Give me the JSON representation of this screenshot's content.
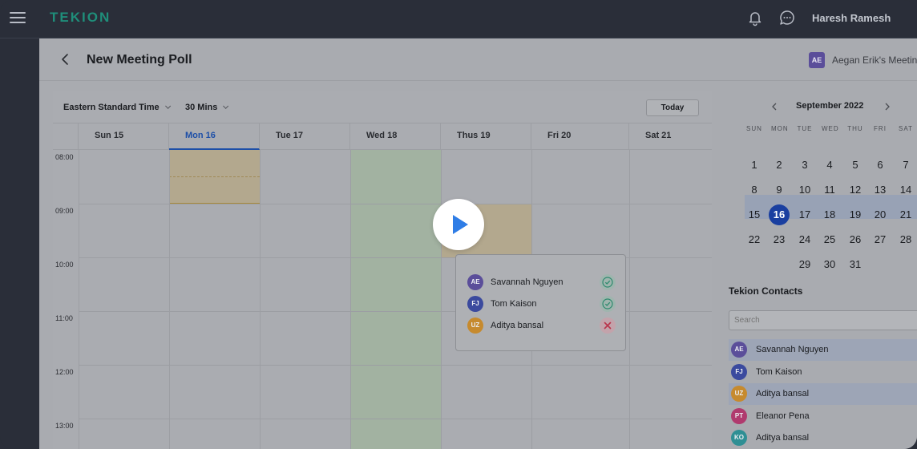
{
  "topbar": {
    "logo": "TEKION",
    "user_name": "Haresh Ramesh",
    "icons": [
      "menu-icon",
      "bell-icon",
      "chat-icon"
    ]
  },
  "header": {
    "title": "New Meeting Poll",
    "owner_initials": "AE",
    "owner_label": "Aegan Erik's Meeting"
  },
  "toolbar": {
    "timezone": "Eastern Standard Time",
    "duration": "30 Mins",
    "today_label": "Today"
  },
  "days": [
    "Sun 15",
    "Mon 16",
    "Tue 17",
    "Wed 18",
    "Thus 19",
    "Fri 20",
    "Sat 21"
  ],
  "active_day": "Mon 16",
  "times": [
    "08:00",
    "09:00",
    "10:00",
    "11:00",
    "12:00",
    "13:00"
  ],
  "popup": {
    "participants": [
      {
        "initials": "AE",
        "name": "Savannah Nguyen",
        "status": "accepted",
        "color": "#5b4e9a"
      },
      {
        "initials": "FJ",
        "name": "Tom Kaison",
        "status": "accepted",
        "color": "#3b4a9e"
      },
      {
        "initials": "UZ",
        "name": "Aditya bansal",
        "status": "declined",
        "color": "#c68a2e"
      }
    ]
  },
  "mini_calendar": {
    "month": "September 2022",
    "weekdays": [
      "SUN",
      "MON",
      "TUE",
      "WED",
      "THU",
      "FRI",
      "SAT"
    ],
    "weeks": [
      [
        "",
        "",
        "",
        "",
        "1",
        "2",
        "3"
      ],
      [
        "",
        "",
        "",
        "",
        "",
        "",
        ""
      ]
    ],
    "rows": [
      [
        "",
        "1",
        "2",
        "3",
        "4",
        "5",
        "6",
        "7"
      ],
      [
        "",
        "8",
        "9",
        "10",
        "11",
        "12",
        "13",
        "14"
      ],
      [
        "",
        "15",
        "16",
        "17",
        "18",
        "19",
        "20",
        "21"
      ],
      [
        "",
        "22",
        "23",
        "24",
        "25",
        "26",
        "27",
        "28"
      ],
      [
        "",
        "",
        "",
        "29",
        "30",
        "31",
        "",
        ""
      ]
    ],
    "selected": "16"
  },
  "contacts": {
    "title": "Tekion Contacts",
    "search_placeholder": "Search",
    "items": [
      {
        "initials": "AE",
        "name": "Savannah Nguyen",
        "color": "#5b4e9a",
        "highlighted": true
      },
      {
        "initials": "FJ",
        "name": "Tom Kaison",
        "color": "#3b4a9e",
        "highlighted": false
      },
      {
        "initials": "UZ",
        "name": "Aditya bansal",
        "color": "#c68a2e",
        "highlighted": true
      },
      {
        "initials": "PT",
        "name": "Eleanor Pena",
        "color": "#b03a6e",
        "highlighted": false
      },
      {
        "initials": "KO",
        "name": "Aditya bansal",
        "color": "#2f8f94",
        "highlighted": false
      }
    ]
  },
  "colors": {
    "accent": "#1d4fa8",
    "brand": "#1f8e7a",
    "accepted": "#2e8a6e",
    "declined": "#b8334a"
  }
}
